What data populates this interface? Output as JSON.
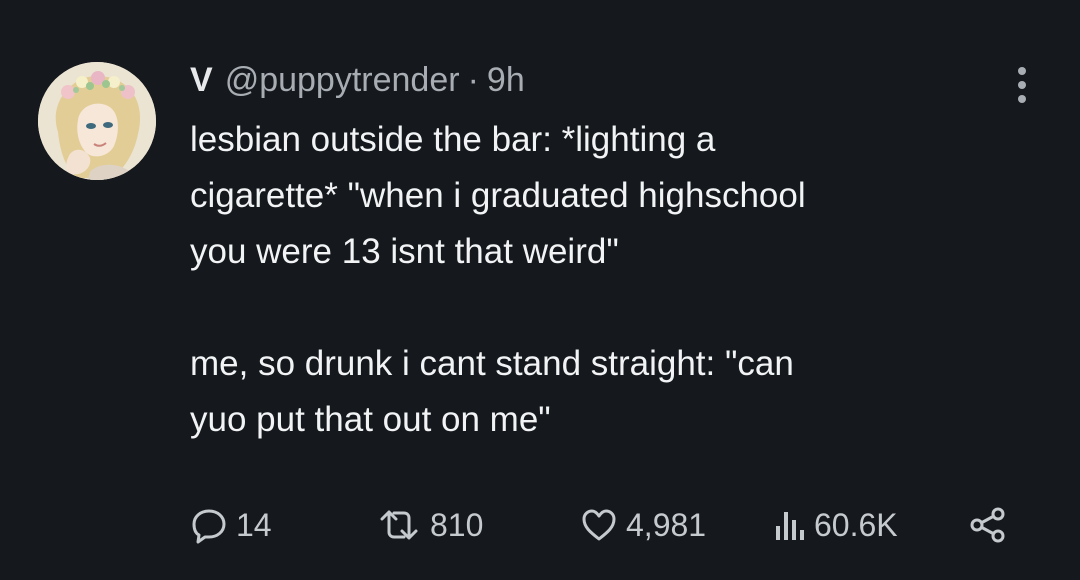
{
  "tweet": {
    "display_name": "V",
    "handle": "@puppytrender",
    "separator": "·",
    "time": "9h",
    "text_lines": [
      "lesbian outside the bar: *lighting a",
      "cigarette* \"when i graduated highschool",
      "you were 13 isnt that weird\""
    ],
    "text_lines_2": [
      "me, so drunk i cant stand straight: \"can",
      "yuo put that out on me\""
    ],
    "avatar_icon": "profile-avatar-flower-crown",
    "more_icon": "more-vertical-icon"
  },
  "actions": {
    "replies": "14",
    "retweets": "810",
    "likes": "4,981",
    "views": "60.6K",
    "reply_icon": "reply-icon",
    "retweet_icon": "retweet-icon",
    "like_icon": "heart-icon",
    "views_icon": "views-chart-icon",
    "share_icon": "share-icon"
  },
  "colors": {
    "background": "#15181d",
    "text": "#e7e9ea",
    "muted": "#a7adb3"
  }
}
